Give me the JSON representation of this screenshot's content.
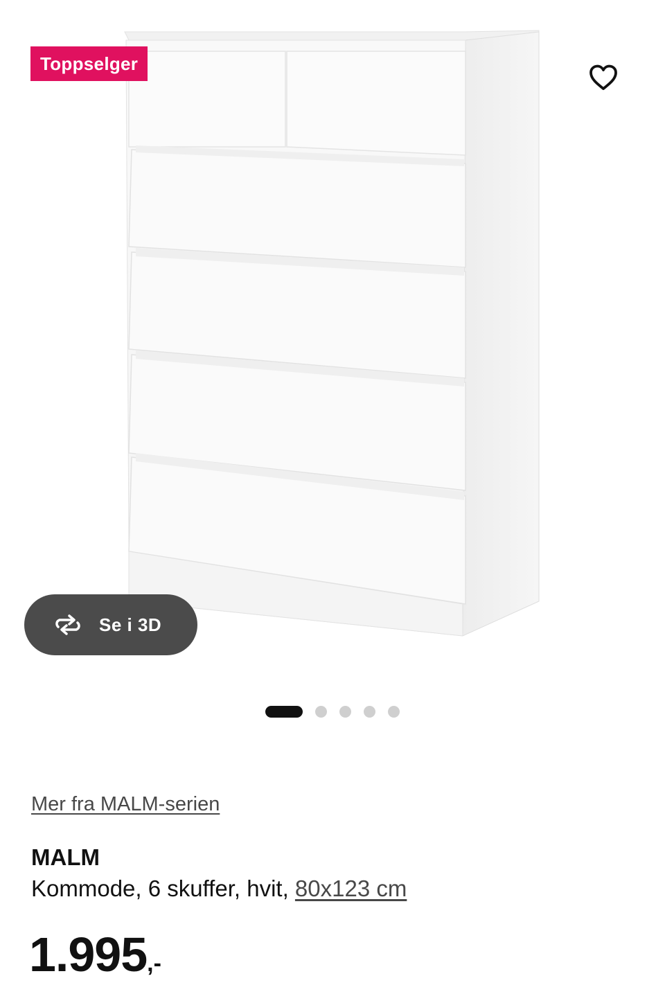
{
  "gallery": {
    "badge": "Toppselger",
    "view3d_label": "Se i 3D",
    "image_count": 5,
    "active_image_index": 0,
    "icons": {
      "favorite": "heart-outline-icon",
      "view3d": "rotate-3d-icon"
    }
  },
  "product": {
    "series_link": "Mer fra MALM-serien",
    "name": "MALM",
    "description": "Kommode, 6 skuffer, hvit,",
    "measure": "80x123 cm",
    "price": {
      "amount": "1.995",
      "suffix": ",-"
    }
  },
  "colors": {
    "badge": "#e0115f",
    "button_bg": "#4b4b4b",
    "text": "#111111",
    "link": "#484848"
  }
}
